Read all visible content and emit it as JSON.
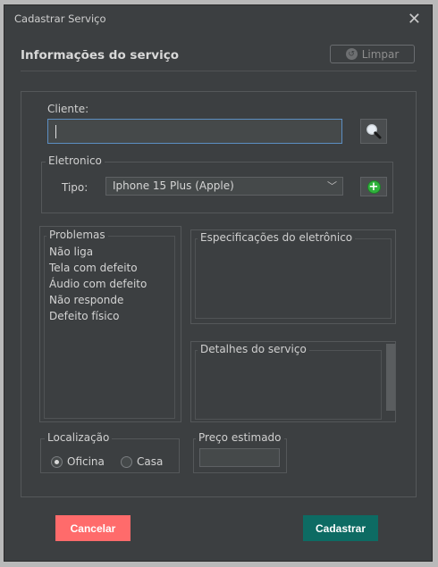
{
  "window": {
    "title": "Cadastrar Serviço",
    "close_glyph": "✕"
  },
  "header": {
    "section_title": "Informações do serviço",
    "clear_label": "Limpar",
    "clear_icon": "reset-icon"
  },
  "client": {
    "label": "Cliente:",
    "value": "",
    "search_icon": "magnifier-icon"
  },
  "electronic": {
    "legend": "Eletronico",
    "type_label": "Tipo:",
    "type_selected": "Iphone 15 Plus (Apple)",
    "add_icon": "green-plus-icon"
  },
  "problems": {
    "legend": "Problemas",
    "items": [
      "Não liga",
      "Tela com defeito",
      "Áudio com defeito",
      "Não responde",
      "Defeito físico"
    ]
  },
  "specs": {
    "legend": "Especificações do eletrônico"
  },
  "details": {
    "legend": "Detalhes do serviço"
  },
  "location": {
    "legend": "Localização",
    "options": [
      {
        "label": "Oficina",
        "selected": true
      },
      {
        "label": "Casa",
        "selected": false
      }
    ]
  },
  "price": {
    "legend": "Preço estimado",
    "value": ""
  },
  "actions": {
    "cancel_label": "Cancelar",
    "submit_label": "Cadastrar"
  },
  "colors": {
    "cancel": "#ff6b6b",
    "submit": "#0d6b63",
    "focus": "#5c8ec2",
    "background": "#3c3f41"
  }
}
